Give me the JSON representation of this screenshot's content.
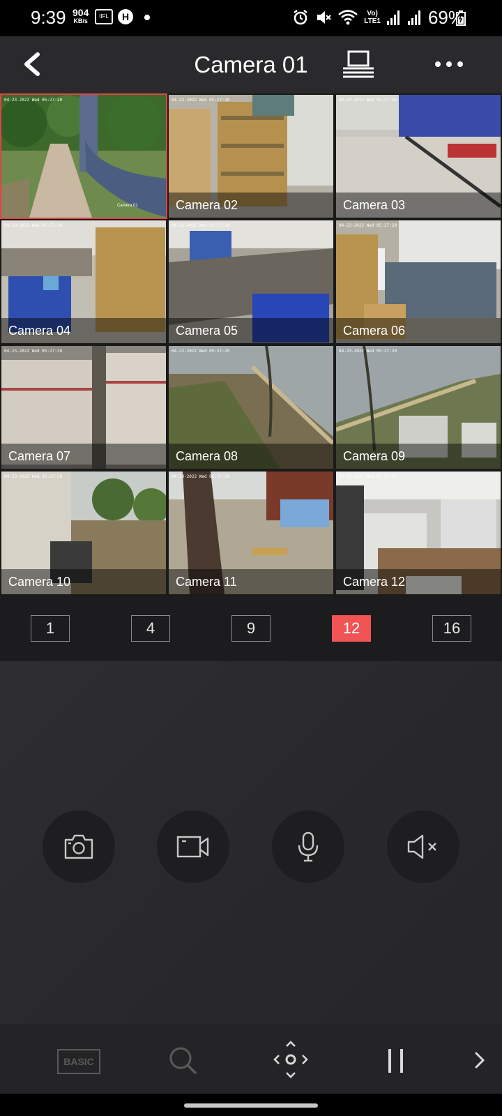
{
  "status_bar": {
    "time": "9:39",
    "net_speed": "904",
    "net_speed_unit": "KB/s",
    "battery_percent": "69%",
    "network_label": "LTE1"
  },
  "header": {
    "title": "Camera 01",
    "icons": [
      "back-icon",
      "view-mode-icon",
      "more-icon"
    ]
  },
  "cameras": [
    {
      "label": "Camera 01",
      "selected": true
    },
    {
      "label": "Camera 02",
      "selected": false
    },
    {
      "label": "Camera 03",
      "selected": false
    },
    {
      "label": "Camera 04",
      "selected": false
    },
    {
      "label": "Camera 05",
      "selected": false
    },
    {
      "label": "Camera 06",
      "selected": false
    },
    {
      "label": "Camera 07",
      "selected": false
    },
    {
      "label": "Camera 08",
      "selected": false
    },
    {
      "label": "Camera 09",
      "selected": false
    },
    {
      "label": "Camera 10",
      "selected": false
    },
    {
      "label": "Camera 11",
      "selected": false
    },
    {
      "label": "Camera 12",
      "selected": false
    }
  ],
  "camera_timestamp": "04-23-2022 Wed 05:27:20",
  "layout_options": {
    "items": [
      "1",
      "4",
      "9",
      "12",
      "16"
    ],
    "selected": "12"
  },
  "controls": [
    "camera-snapshot-icon",
    "record-video-icon",
    "microphone-icon",
    "speaker-muted-icon"
  ],
  "toolbar": {
    "basic_label": "BASIC",
    "icons": [
      "basic-icon",
      "search-icon",
      "ptz-icon",
      "pause-icon",
      "next-icon"
    ]
  },
  "colors": {
    "accent": "#f05454",
    "selected_border": "#e24444",
    "header_bg": "#2a2a2c",
    "control_bg": "#2b2b2d"
  }
}
